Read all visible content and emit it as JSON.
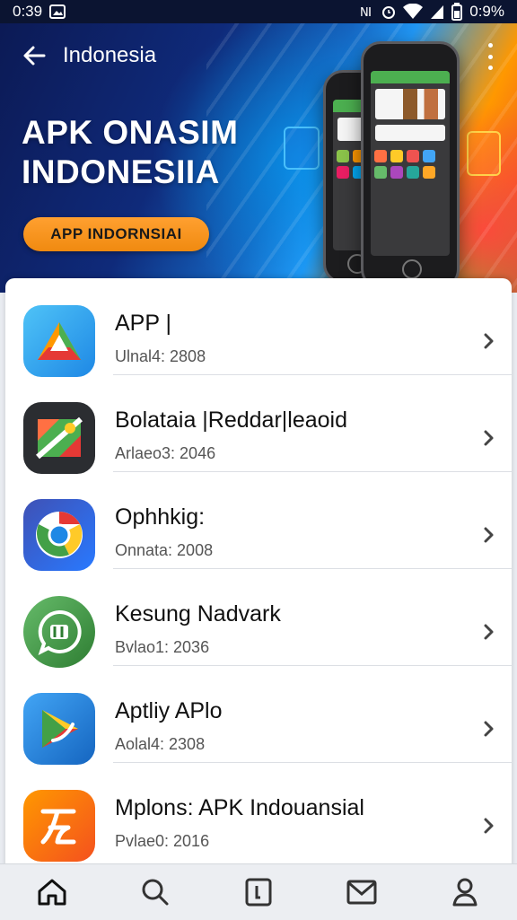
{
  "status_bar": {
    "time": "0:39",
    "battery_text": "0:9%",
    "icons": [
      "image-icon",
      "nfc-icon",
      "alarm-icon",
      "wifi-icon",
      "signal-icon",
      "battery-icon"
    ]
  },
  "app_bar": {
    "title": "Indonesia",
    "icons": [
      "back-arrow-icon",
      "more-vertical-icon"
    ]
  },
  "hero": {
    "title_line1": "APK ONASIM",
    "title_line2": "INDONESIIA",
    "cta_label": "APP INDORNSIAI",
    "colors": {
      "cta": "#f49a1c",
      "bg_dark": "#0c1a55"
    }
  },
  "apps": [
    {
      "title": "APP |",
      "subtitle": "Ulnal4: 2808",
      "icon": "triangle-app-icon"
    },
    {
      "title": "Bolataia |Reddar|leaoid",
      "subtitle": "Arlaeo3: 2046",
      "icon": "map-app-icon"
    },
    {
      "title": "Ophhkig:",
      "subtitle": "Onnata: 2008",
      "icon": "chrome-like-app-icon"
    },
    {
      "title": "Kesung Nadvark",
      "subtitle": "Bvlao1: 2036",
      "icon": "chat-app-icon"
    },
    {
      "title": "Aptliy APlo",
      "subtitle": "Aolal4: 2308",
      "icon": "play-app-icon"
    },
    {
      "title": "Mplons: APK Indouansial",
      "subtitle": "Pvlae0: 2016",
      "icon": "letter-app-icon"
    }
  ],
  "bottom_nav": [
    "home-icon",
    "search-icon",
    "tablet-icon",
    "mail-icon",
    "profile-icon"
  ]
}
